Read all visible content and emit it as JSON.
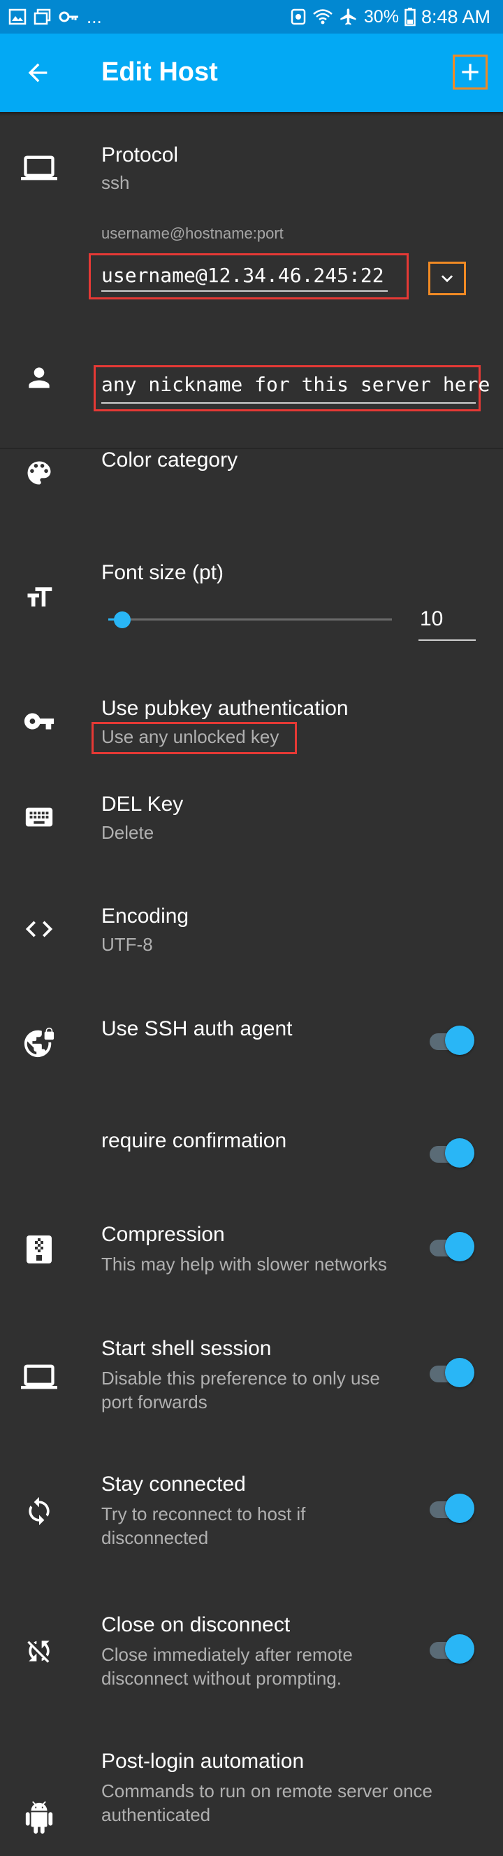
{
  "status_bar": {
    "ellipsis": "...",
    "battery_percent": "30%",
    "time": "8:48 AM"
  },
  "app_bar": {
    "title": "Edit Host"
  },
  "protocol": {
    "title": "Protocol",
    "value": "ssh",
    "uri_hint": "username@hostname:port",
    "uri_value": "username@12.34.46.245:22"
  },
  "nickname": {
    "value": "any nickname for this server here"
  },
  "color_category": {
    "title": "Color category"
  },
  "font_size": {
    "title": "Font size (pt)",
    "value": "10",
    "slider_fraction": 0.05
  },
  "pubkey": {
    "title": "Use pubkey authentication",
    "value": "Use any unlocked key"
  },
  "del_key": {
    "title": "DEL Key",
    "value": "Delete"
  },
  "encoding": {
    "title": "Encoding",
    "value": "UTF-8"
  },
  "auth_agent": {
    "title": "Use SSH auth agent",
    "enabled": true
  },
  "require_confirmation": {
    "title": "require confirmation",
    "enabled": true
  },
  "compression": {
    "title": "Compression",
    "summary": "This may help with slower networks",
    "enabled": true
  },
  "shell_session": {
    "title": "Start shell session",
    "summary_line1": "Disable this preference to only use",
    "summary_line2": "port forwards",
    "enabled": true
  },
  "stay_connected": {
    "title": "Stay connected",
    "summary_line1": "Try to reconnect to host if",
    "summary_line2": "disconnected",
    "enabled": true
  },
  "close_on_disconnect": {
    "title": "Close on disconnect",
    "summary_line1": "Close immediately after remote",
    "summary_line2": "disconnect without prompting.",
    "enabled": true
  },
  "post_login": {
    "title": "Post-login automation",
    "summary_line1": "Commands to run on remote server once",
    "summary_line2": "authenticated"
  },
  "colors": {
    "status_bar": "#0288d1",
    "app_bar": "#03a9f4",
    "background": "#303030",
    "accent": "#29b6f6",
    "highlight_red": "#e53935",
    "highlight_orange": "#f08a24"
  }
}
